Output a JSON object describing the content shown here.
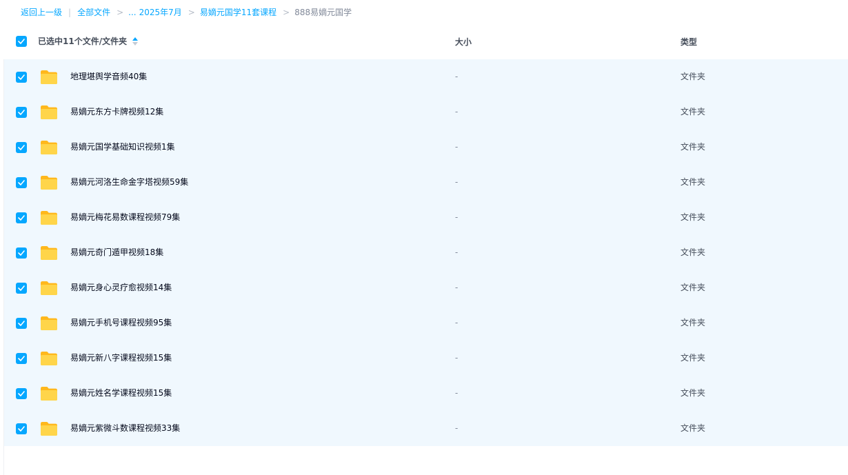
{
  "breadcrumb": {
    "back": "返回上一级",
    "separator": "|",
    "all_files": "全部文件",
    "ellipsis": "...",
    "path": [
      "2025年7月",
      "易嫡元国学11套课程"
    ],
    "current": "888易嫡元国学",
    "arrow": ">"
  },
  "header": {
    "selected_text": "已选中11个文件/文件夹",
    "size_label": "大小",
    "type_label": "类型",
    "checked": true
  },
  "colors": {
    "accent": "#06a7ff",
    "row_selected_bg": "#f0f8fe",
    "folder_yellow": "#ffc933"
  },
  "files": [
    {
      "name": "地理堪舆学音频40集",
      "size": "-",
      "type": "文件夹",
      "checked": true,
      "icon": "folder-icon"
    },
    {
      "name": "易嫡元东方卡牌视频12集",
      "size": "-",
      "type": "文件夹",
      "checked": true,
      "icon": "folder-icon"
    },
    {
      "name": "易嫡元国学基础知识视频1集",
      "size": "-",
      "type": "文件夹",
      "checked": true,
      "icon": "folder-icon"
    },
    {
      "name": "易嫡元河洛生命金字塔视频59集",
      "size": "-",
      "type": "文件夹",
      "checked": true,
      "icon": "folder-icon"
    },
    {
      "name": "易嫡元梅花易数课程视频79集",
      "size": "-",
      "type": "文件夹",
      "checked": true,
      "icon": "folder-icon"
    },
    {
      "name": "易嫡元奇门遁甲视频18集",
      "size": "-",
      "type": "文件夹",
      "checked": true,
      "icon": "folder-icon"
    },
    {
      "name": "易嫡元身心灵疗愈视频14集",
      "size": "-",
      "type": "文件夹",
      "checked": true,
      "icon": "folder-icon"
    },
    {
      "name": "易嫡元手机号课程视频95集",
      "size": "-",
      "type": "文件夹",
      "checked": true,
      "icon": "folder-icon"
    },
    {
      "name": "易嫡元新八字课程视频15集",
      "size": "-",
      "type": "文件夹",
      "checked": true,
      "icon": "folder-icon"
    },
    {
      "name": "易嫡元姓名学课程视频15集",
      "size": "-",
      "type": "文件夹",
      "checked": true,
      "icon": "folder-icon"
    },
    {
      "name": "易嫡元紫微斗数课程视频33集",
      "size": "-",
      "type": "文件夹",
      "checked": true,
      "icon": "folder-icon"
    }
  ]
}
